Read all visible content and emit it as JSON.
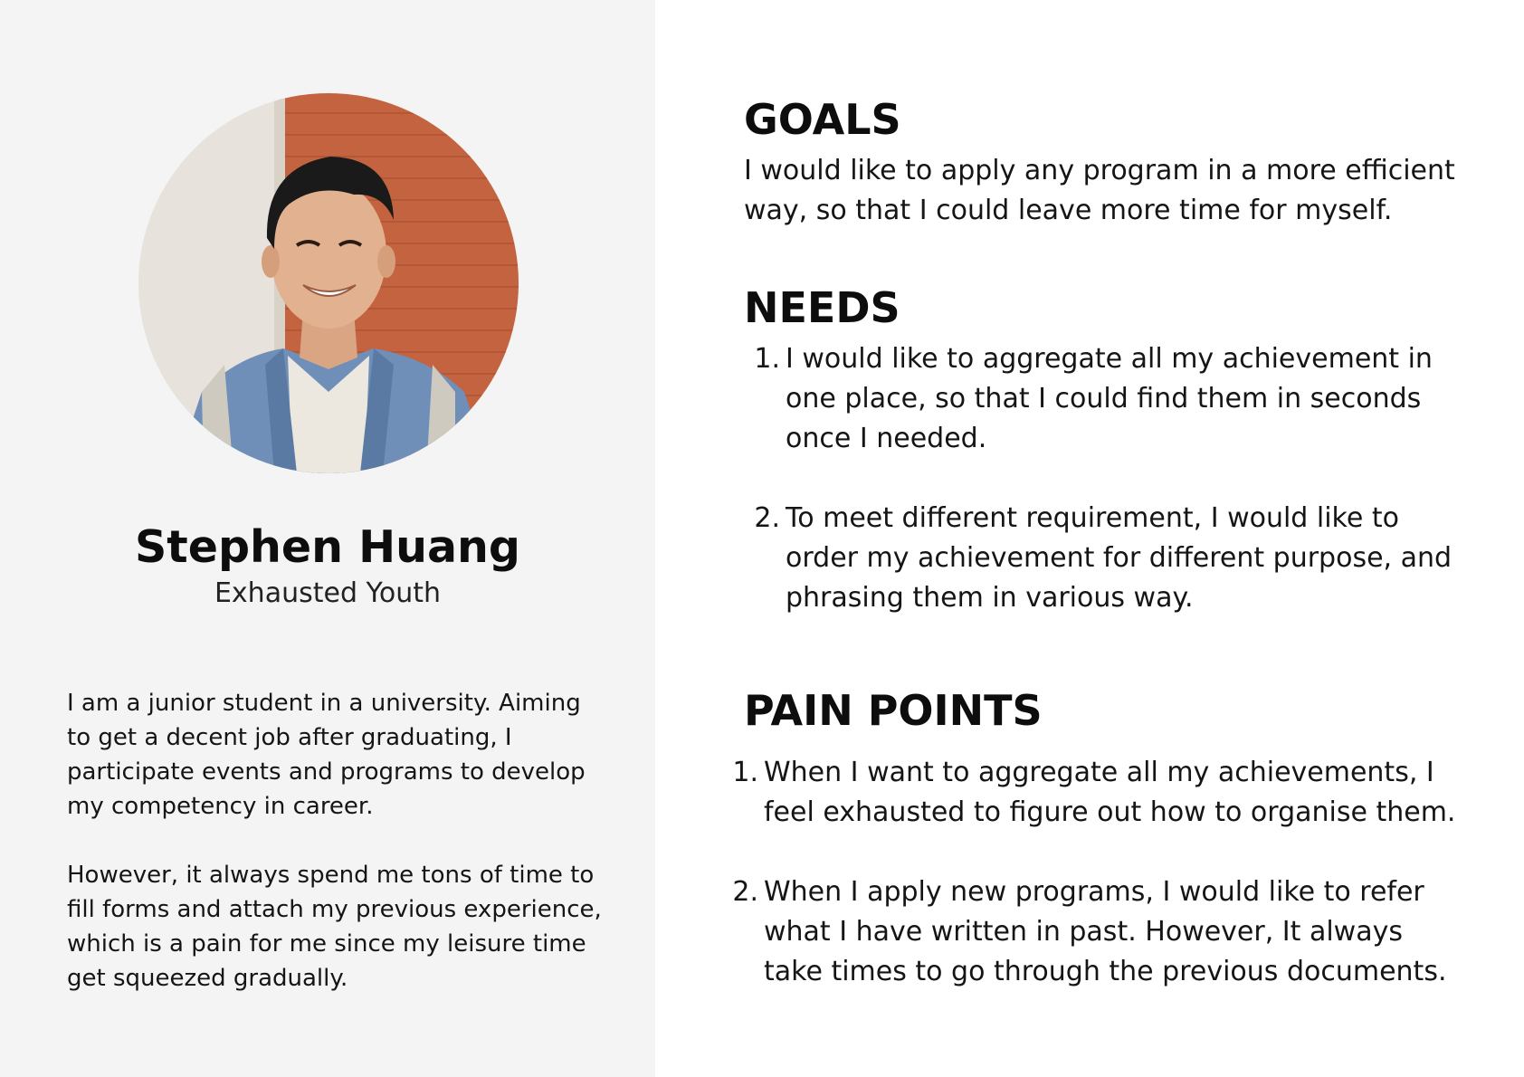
{
  "persona": {
    "name": "Stephen Huang",
    "role": "Exhausted Youth",
    "bio": [
      "I am a junior student in a university. Aiming to get a decent job after graduating, I participate events and programs to develop my competency in career.",
      "However, it always spend me tons of time to fill forms and attach my previous experience, which is a pain for me since my leisure time get squeezed gradually."
    ]
  },
  "goals": {
    "heading": "GOALS",
    "text": "I would like to apply any program in a more efficient way, so that I could leave more time for myself."
  },
  "needs": {
    "heading": "NEEDS",
    "items": [
      {
        "marker": "1.",
        "text": "I would like to aggregate all my achievement in one place, so that I could find them in seconds once I needed."
      },
      {
        "marker": "2.",
        "text": "To meet different requirement, I would like to order my achievement for different purpose, and phrasing them in various way."
      }
    ]
  },
  "pain_points": {
    "heading": "PAIN POINTS",
    "items": [
      {
        "marker": "1.",
        "text": "When I want to aggregate all my achievements, I feel exhausted to figure out how to organise them."
      },
      {
        "marker": "2.",
        "text": "When I apply new programs, I would like to refer what I have written in past. However, It always take times to go through the previous documents."
      }
    ]
  },
  "colors": {
    "left_panel_bg": "#f4f4f4",
    "page_bg": "#ffffff",
    "text": "#111111",
    "brick": "#c4633f"
  }
}
